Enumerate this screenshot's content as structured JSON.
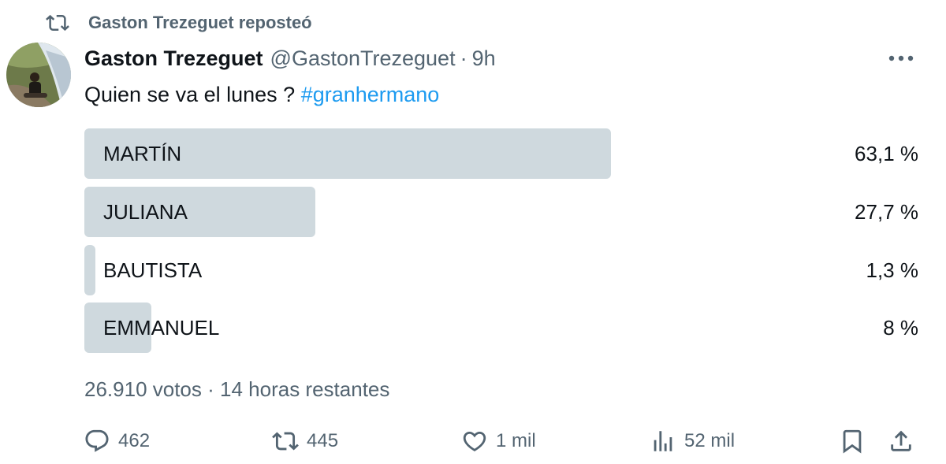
{
  "repost": {
    "icon": "repost-icon",
    "text": "Gaston Trezeguet reposteó"
  },
  "tweet": {
    "avatar_icon": "avatar-photo",
    "author_name": "Gaston Trezeguet",
    "handle": "@GastonTrezeguet",
    "separator": "·",
    "time": "9h",
    "more_icon": "more-options-icon",
    "text": "Quien se va el lunes ?",
    "hashtag": "#granhermano"
  },
  "poll": {
    "options": [
      {
        "label": "MARTÍN",
        "percent_text": "63,1 %",
        "fraction": 0.631
      },
      {
        "label": "JULIANA",
        "percent_text": "27,7 %",
        "fraction": 0.277
      },
      {
        "label": "BAUTISTA",
        "percent_text": "1,3 %",
        "fraction": 0.013
      },
      {
        "label": "EMMANUEL",
        "percent_text": "8 %",
        "fraction": 0.08
      }
    ],
    "votes": "26.910 votos",
    "separator": "·",
    "remaining": "14 horas restantes"
  },
  "actions": {
    "reply": {
      "icon": "reply-icon",
      "count": "462"
    },
    "repost": {
      "icon": "repost-icon",
      "count": "445"
    },
    "like": {
      "icon": "heart-icon",
      "count": "1 mil"
    },
    "views": {
      "icon": "views-chart-icon",
      "count": "52 mil"
    },
    "bookmark": {
      "icon": "bookmark-icon"
    },
    "share": {
      "icon": "share-icon"
    }
  },
  "colors": {
    "text": "#0f1419",
    "secondary": "#536471",
    "accent": "#1d9bf0",
    "poll_bar": "#cfd9de"
  }
}
